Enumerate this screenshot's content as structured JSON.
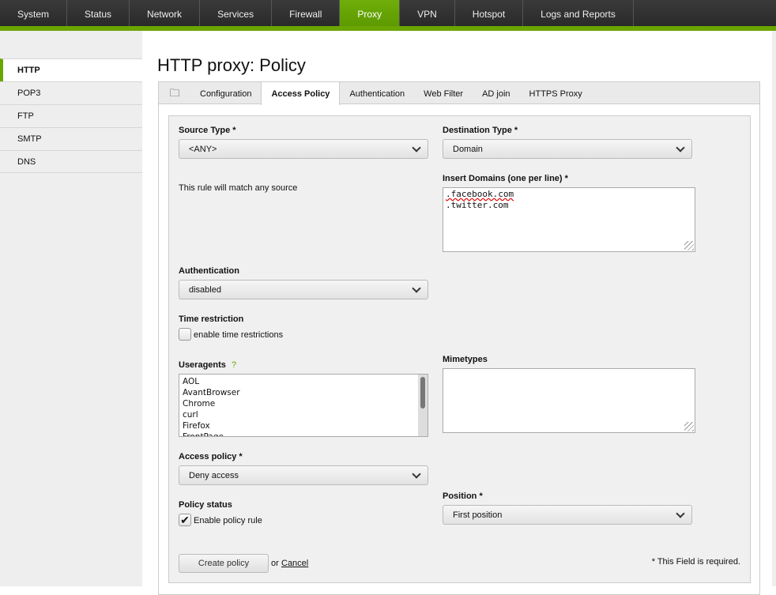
{
  "nav": {
    "items": [
      "System",
      "Status",
      "Network",
      "Services",
      "Firewall",
      "Proxy",
      "VPN",
      "Hotspot",
      "Logs and Reports"
    ],
    "active": "Proxy"
  },
  "sidebar": {
    "items": [
      "HTTP",
      "POP3",
      "FTP",
      "SMTP",
      "DNS"
    ],
    "active": "HTTP"
  },
  "page_title": "HTTP proxy: Policy",
  "tabs": {
    "items": [
      "Configuration",
      "Access Policy",
      "Authentication",
      "Web Filter",
      "AD join",
      "HTTPS Proxy"
    ],
    "active": "Access Policy"
  },
  "form": {
    "source_type": {
      "label": "Source Type *",
      "value": "<ANY>",
      "note": "This rule will match any source"
    },
    "destination_type": {
      "label": "Destination Type *",
      "value": "Domain"
    },
    "domains": {
      "label": "Insert Domains (one per line) *",
      "lines": [
        ".facebook.com",
        ".twitter.com"
      ]
    },
    "authentication": {
      "label": "Authentication",
      "value": "disabled"
    },
    "time_restriction": {
      "label": "Time restriction",
      "checkbox_label": "enable time restrictions",
      "checked": false
    },
    "useragents": {
      "label": "Useragents",
      "help": "?",
      "items": [
        "AOL",
        "AvantBrowser",
        "Chrome",
        "curl",
        "Firefox",
        "FrontPage"
      ]
    },
    "mimetypes": {
      "label": "Mimetypes",
      "value": ""
    },
    "access_policy": {
      "label": "Access policy *",
      "value": "Deny access"
    },
    "policy_status": {
      "label": "Policy status",
      "checkbox_label": "Enable policy rule",
      "checked": true
    },
    "position": {
      "label": "Position *",
      "value": "First position"
    },
    "create_label": "Create policy",
    "or": "or",
    "cancel_label": "Cancel",
    "required_note": "* This Field is required."
  },
  "colors": {
    "accent": "#6aa500",
    "nav_bg": "#2f2f2f"
  }
}
